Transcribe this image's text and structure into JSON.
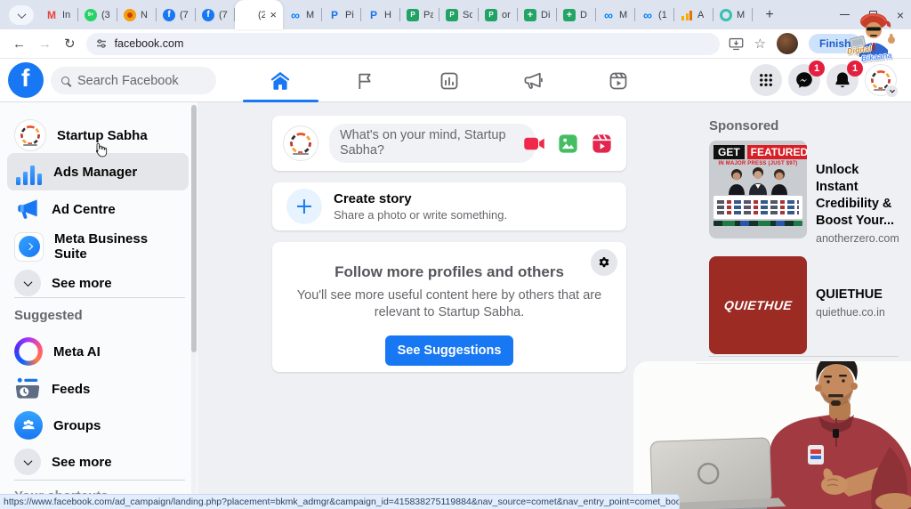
{
  "colors": {
    "fb_blue": "#1877f2",
    "badge_red": "#e41e3f",
    "ad2_bg": "#9c2b24",
    "status_bg": "#e3edfb"
  },
  "browser": {
    "tab_strip": {
      "tabs": [
        {
          "label": "In",
          "icon": "gmail"
        },
        {
          "label": "(3",
          "icon": "green-badge"
        },
        {
          "label": "N",
          "icon": "orange"
        },
        {
          "label": "(7",
          "icon": "fb"
        },
        {
          "label": "(7",
          "icon": "fb"
        },
        {
          "label": "(2",
          "icon": "none",
          "active": true,
          "close": "×"
        },
        {
          "label": "M",
          "icon": "meta"
        },
        {
          "label": "Pi",
          "icon": "p-blue"
        },
        {
          "label": "H",
          "icon": "p-blue"
        },
        {
          "label": "Pa",
          "icon": "green-sq"
        },
        {
          "label": "Sc",
          "icon": "green-sq"
        },
        {
          "label": "or",
          "icon": "green-sq"
        },
        {
          "label": "Di",
          "icon": "green-plus"
        },
        {
          "label": "D",
          "icon": "green-plus"
        },
        {
          "label": "M",
          "icon": "meta"
        },
        {
          "label": "(1",
          "icon": "meta"
        },
        {
          "label": "A",
          "icon": "chart-orange"
        },
        {
          "label": "M",
          "icon": "teal"
        }
      ],
      "new_tab": "+"
    },
    "window_controls": {
      "close": "×"
    },
    "toolbar": {
      "url": "facebook.com",
      "finish_button": "Finish"
    },
    "status_url": "https://www.facebook.com/ad_campaign/landing.php?placement=bkmk_admgr&campaign_id=415838275119884&nav_source=comet&nav_entry_point=comet_bookmark&extr"
  },
  "header": {
    "search_placeholder": "Search Facebook",
    "messenger_badge": "1",
    "notifications_badge": "1"
  },
  "sidebar": {
    "items": [
      {
        "label": "Startup Sabha"
      },
      {
        "label": "Ads Manager"
      },
      {
        "label": "Ad Centre"
      },
      {
        "label": "Meta Business Suite"
      },
      {
        "label": "See more"
      }
    ],
    "suggested": {
      "heading": "Suggested",
      "items": [
        {
          "label": "Meta AI"
        },
        {
          "label": "Feeds"
        },
        {
          "label": "Groups"
        },
        {
          "label": "See more"
        }
      ]
    },
    "shortcuts_heading": "Your shortcuts"
  },
  "composer": {
    "placeholder": "What's on your mind, Startup Sabha?"
  },
  "create_story": {
    "title": "Create story",
    "subtitle": "Share a photo or write something."
  },
  "follow_card": {
    "title": "Follow more profiles and others",
    "body": "You'll see more useful content here by others that are relevant to Startup Sabha.",
    "button": "See Suggestions"
  },
  "sponsored": {
    "heading": "Sponsored",
    "ads": [
      {
        "title": "Unlock Instant Credibility & Boost Your...",
        "domain": "anotherzero.com",
        "image": {
          "line1": "GET",
          "line2": "FEATURED",
          "subline": "IN MAJOR PRESS (JUST $97)"
        }
      },
      {
        "title": "QUIETHUE",
        "domain": "quiethue.co.in",
        "image": {
          "text": "QUIETHUE"
        }
      }
    ]
  },
  "brand_overlay": {
    "line1": "Digital",
    "line2": "Bikaana"
  }
}
